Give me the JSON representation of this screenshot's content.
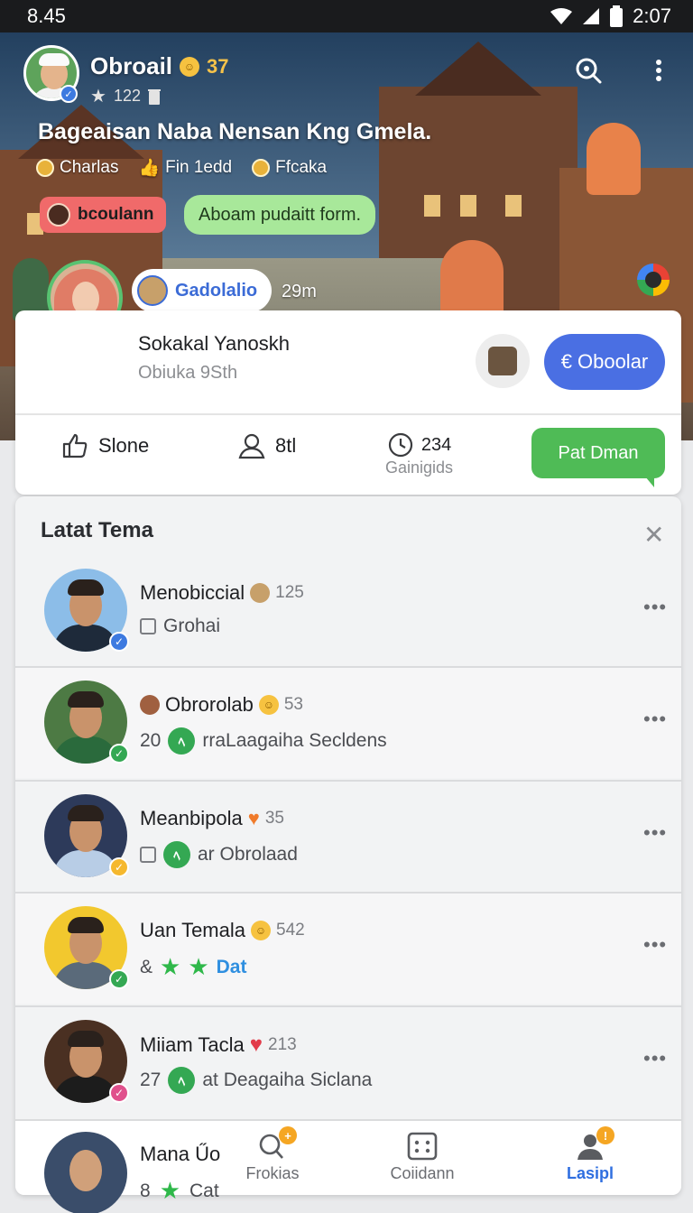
{
  "status_bar": {
    "time_left": "8.45",
    "time_right": "2:07"
  },
  "header": {
    "name": "Obroail",
    "score": "37",
    "sub_count": "122",
    "headline": "Bageaisan Naba Nensan Kng Gmela.",
    "meta": [
      {
        "icon": "coin-icon",
        "label": "Charlas"
      },
      {
        "icon": "thumb-icon",
        "label": "Fin  1edd"
      },
      {
        "icon": "coin-icon",
        "label": "Ffcaka"
      }
    ],
    "chip_red": "bcoulann",
    "chip_green": "Aboam pudaitt form.",
    "profile_pill": "Gadolalio",
    "profile_time": "29m"
  },
  "card": {
    "name": "Sokakal Yanoskh",
    "sub": "Obiuka 9Sth",
    "button": "Oboolar",
    "button_icon": "€",
    "actions": {
      "like": "Slone",
      "people": "8tl",
      "time_value": "234",
      "time_label": "Gainigids",
      "green_button": "Pat Dman"
    }
  },
  "list": {
    "title": "Latat Tema",
    "rows": [
      {
        "title": "Menobiccial",
        "count": "125",
        "sub_prefix": "",
        "sub": "Grohai",
        "badge_color": "#3d7ae0"
      },
      {
        "title": "Obrorolab",
        "count": "53",
        "sub_prefix": "20",
        "sub": "rraLaagaiha Secldens",
        "badge_color": "#34a853"
      },
      {
        "title": "Meanbipola",
        "count": "35",
        "sub_prefix": "",
        "sub": "ar Obrolaad",
        "badge_color": "#f5b82e"
      },
      {
        "title": "Uan Temala",
        "count": "542",
        "sub_prefix": "&",
        "sub": "Dat",
        "badge_color": "#34a853"
      },
      {
        "title": "Miiam Tacla",
        "count": "213",
        "sub_prefix": "27",
        "sub": "at Deagaiha Siclana",
        "badge_color": "#e0508c"
      }
    ],
    "partial_row": {
      "title": "Mana Űo",
      "sub_prefix": "8",
      "sub": "Cat"
    }
  },
  "bottom_nav": {
    "items": [
      {
        "label": "Frokias",
        "badge": "+"
      },
      {
        "label": "Coiidann",
        "badge": ""
      },
      {
        "label": "Lasipl",
        "badge": "!"
      }
    ],
    "active_color": "#2f6fe0"
  }
}
